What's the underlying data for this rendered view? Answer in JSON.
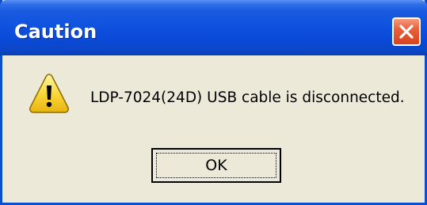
{
  "window": {
    "title": "Caution",
    "close_icon": "close-icon",
    "titlebar_color": "#0a4fd0",
    "close_color": "#d8431c",
    "body_color": "#ece9d8"
  },
  "dialog": {
    "icon": "warning-icon",
    "message": "LDP-7024(24D) USB cable is disconnected.",
    "ok_label": "OK"
  }
}
